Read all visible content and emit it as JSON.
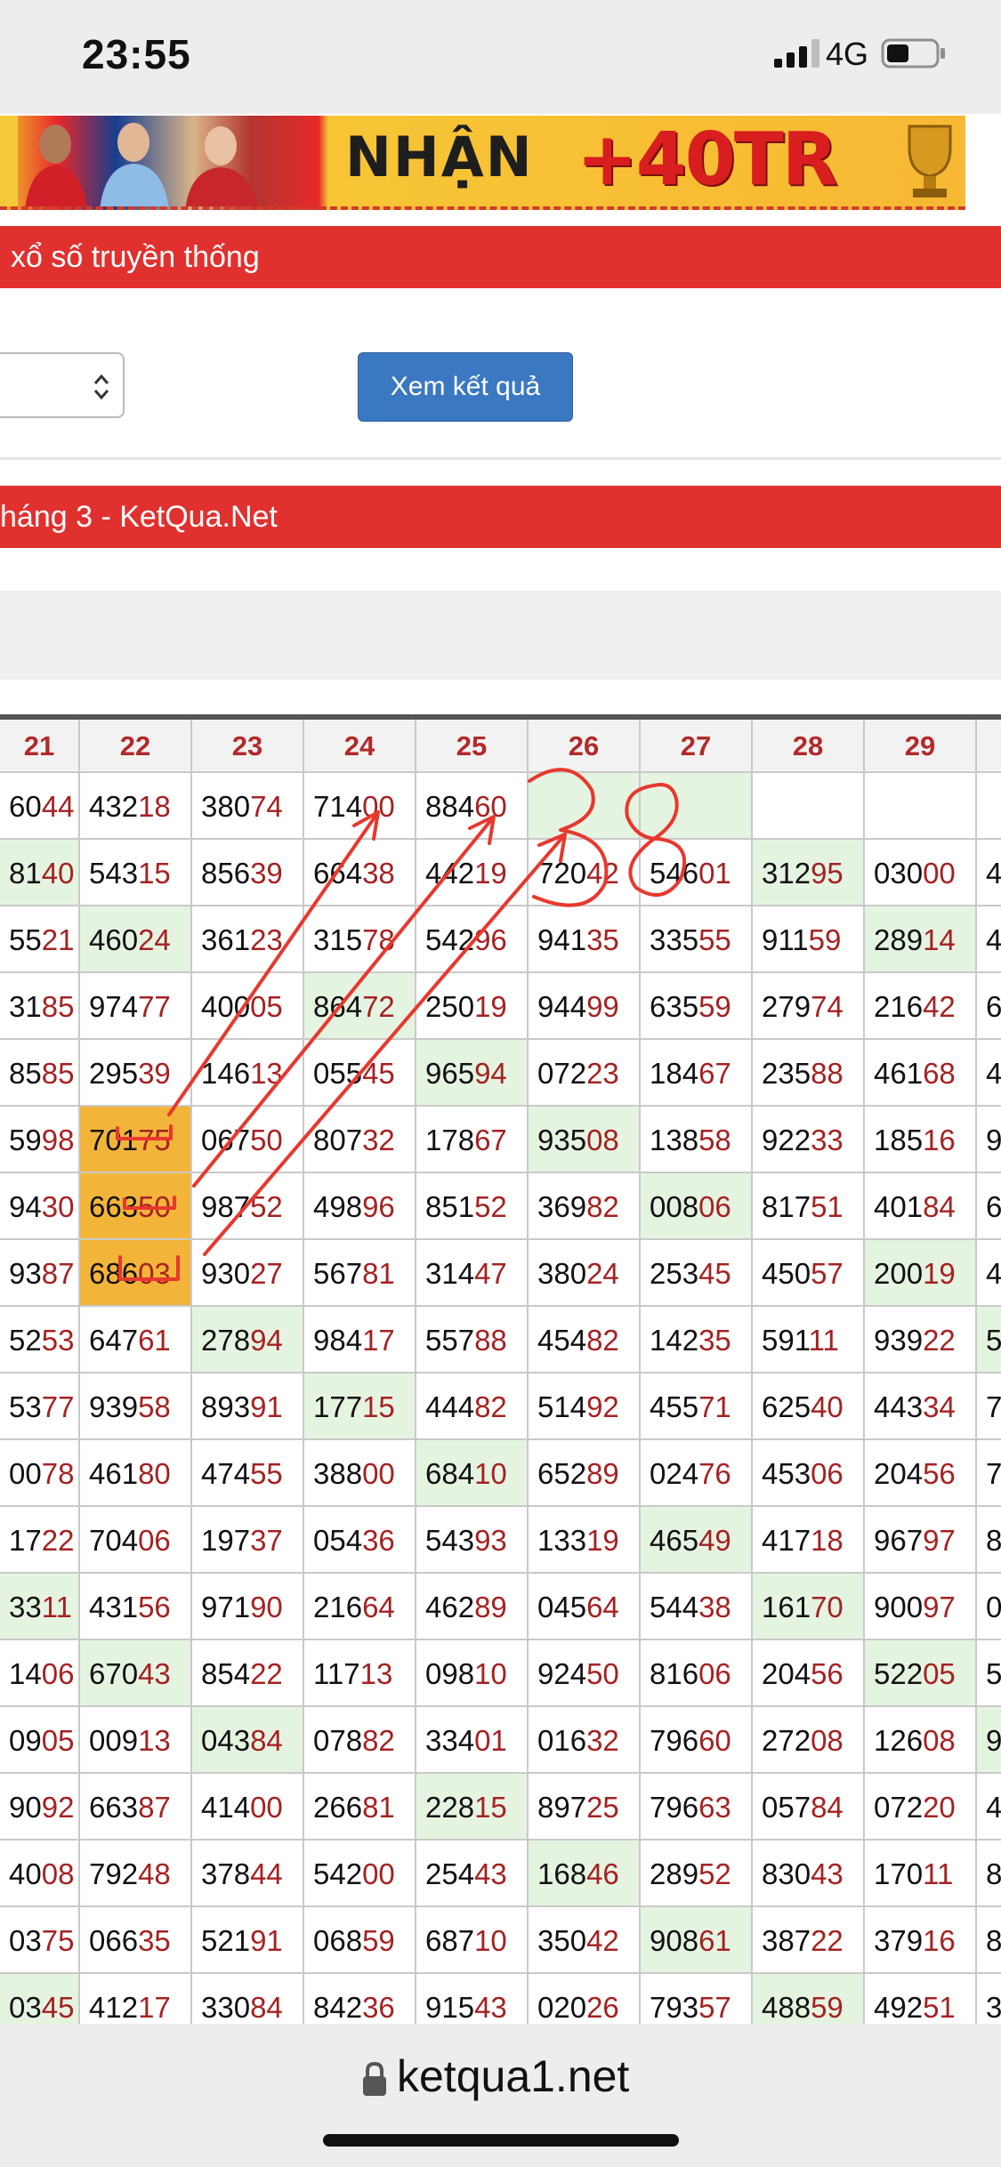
{
  "status_bar": {
    "time": "23:55",
    "network": "4G"
  },
  "banner": {
    "text": "NHẬN",
    "amount": "+40TR"
  },
  "section_title": "xổ số truyền thống",
  "controls": {
    "view_button": "Xem kết quả"
  },
  "month_title": "háng 3 - KetQua.Net",
  "table": {
    "columns": [
      "21",
      "22",
      "23",
      "24",
      "25",
      "26",
      "27",
      "28",
      "29",
      ""
    ],
    "rows": [
      [
        "6044",
        "43218",
        "38074",
        "71400",
        "88460",
        "",
        "",
        "",
        "",
        ""
      ],
      [
        "8140",
        "54315",
        "85639",
        "66438",
        "44219",
        "72042",
        "54601",
        "31295",
        "03000",
        "4"
      ],
      [
        "5521",
        "46024",
        "36123",
        "31578",
        "54296",
        "94135",
        "33555",
        "91159",
        "28914",
        "4"
      ],
      [
        "3185",
        "97477",
        "40005",
        "86472",
        "25019",
        "94499",
        "63559",
        "27974",
        "21642",
        "6"
      ],
      [
        "8585",
        "29539",
        "14613",
        "05545",
        "96594",
        "07223",
        "18467",
        "23588",
        "46168",
        "4"
      ],
      [
        "5998",
        "70175",
        "06750",
        "80732",
        "17867",
        "93508",
        "13858",
        "92233",
        "18516",
        "9"
      ],
      [
        "9430",
        "66350",
        "98752",
        "49896",
        "85152",
        "36982",
        "00806",
        "81751",
        "40184",
        "6"
      ],
      [
        "9387",
        "68603",
        "93027",
        "56781",
        "31447",
        "38024",
        "25345",
        "45057",
        "20019",
        "4"
      ],
      [
        "5253",
        "64761",
        "27894",
        "98417",
        "55788",
        "45482",
        "14235",
        "59111",
        "93922",
        "5"
      ],
      [
        "5377",
        "93958",
        "89391",
        "17715",
        "44482",
        "51492",
        "45571",
        "62540",
        "44334",
        "7"
      ],
      [
        "0078",
        "46180",
        "47455",
        "38800",
        "68410",
        "65289",
        "02476",
        "45306",
        "20456",
        "7"
      ],
      [
        "1722",
        "70406",
        "19737",
        "05436",
        "54393",
        "13319",
        "46549",
        "41718",
        "96797",
        "8"
      ],
      [
        "3311",
        "43156",
        "97190",
        "21664",
        "46289",
        "04564",
        "54438",
        "16170",
        "90097",
        "0"
      ],
      [
        "1406",
        "67043",
        "85422",
        "11713",
        "09810",
        "92450",
        "81606",
        "20456",
        "52205",
        "5"
      ],
      [
        "0905",
        "00913",
        "04384",
        "07882",
        "33401",
        "01632",
        "79660",
        "27208",
        "12608",
        "9"
      ],
      [
        "9092",
        "66387",
        "41400",
        "26681",
        "22815",
        "89725",
        "79663",
        "05784",
        "07220",
        "4"
      ],
      [
        "4008",
        "79248",
        "37844",
        "54200",
        "25443",
        "16846",
        "28952",
        "83043",
        "17011",
        "8"
      ],
      [
        "0375",
        "06635",
        "52191",
        "06859",
        "68710",
        "35042",
        "90861",
        "38722",
        "37916",
        "8"
      ],
      [
        "0345",
        "41217",
        "33084",
        "84236",
        "91543",
        "02026",
        "79357",
        "48859",
        "49251",
        "3"
      ]
    ],
    "green_cells": [
      [
        0,
        5
      ],
      [
        0,
        6
      ],
      [
        1,
        0
      ],
      [
        1,
        7
      ],
      [
        2,
        1
      ],
      [
        2,
        8
      ],
      [
        3,
        3
      ],
      [
        4,
        4
      ],
      [
        5,
        5
      ],
      [
        6,
        6
      ],
      [
        7,
        8
      ],
      [
        8,
        2
      ],
      [
        8,
        9
      ],
      [
        9,
        3
      ],
      [
        10,
        4
      ],
      [
        11,
        6
      ],
      [
        12,
        0
      ],
      [
        12,
        7
      ],
      [
        13,
        1
      ],
      [
        13,
        8
      ],
      [
        14,
        2
      ],
      [
        14,
        9
      ],
      [
        15,
        4
      ],
      [
        16,
        5
      ],
      [
        17,
        6
      ],
      [
        18,
        0
      ],
      [
        18,
        7
      ]
    ],
    "orange_cells": [
      [
        5,
        1
      ],
      [
        6,
        1
      ],
      [
        7,
        1
      ]
    ]
  },
  "annotation": {
    "handwritten": "38",
    "color": "#e8382e"
  },
  "address_bar": {
    "url": "ketqua1.net"
  }
}
